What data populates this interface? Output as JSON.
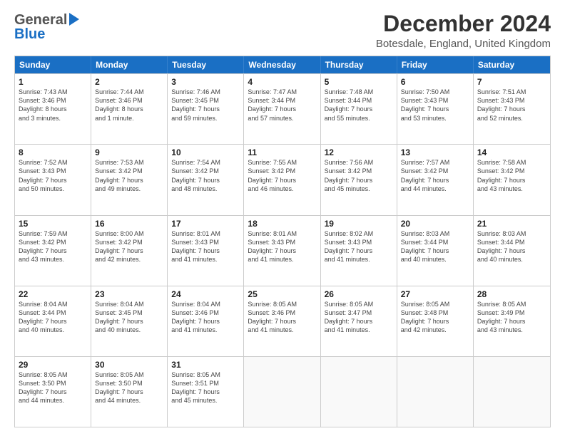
{
  "logo": {
    "line1": "General",
    "line2": "Blue",
    "icon": "▶"
  },
  "title": {
    "month": "December 2024",
    "location": "Botesdale, England, United Kingdom"
  },
  "header_days": [
    "Sunday",
    "Monday",
    "Tuesday",
    "Wednesday",
    "Thursday",
    "Friday",
    "Saturday"
  ],
  "weeks": [
    [
      {
        "day": "1",
        "info": "Sunrise: 7:43 AM\nSunset: 3:46 PM\nDaylight: 8 hours\nand 3 minutes."
      },
      {
        "day": "2",
        "info": "Sunrise: 7:44 AM\nSunset: 3:46 PM\nDaylight: 8 hours\nand 1 minute."
      },
      {
        "day": "3",
        "info": "Sunrise: 7:46 AM\nSunset: 3:45 PM\nDaylight: 7 hours\nand 59 minutes."
      },
      {
        "day": "4",
        "info": "Sunrise: 7:47 AM\nSunset: 3:44 PM\nDaylight: 7 hours\nand 57 minutes."
      },
      {
        "day": "5",
        "info": "Sunrise: 7:48 AM\nSunset: 3:44 PM\nDaylight: 7 hours\nand 55 minutes."
      },
      {
        "day": "6",
        "info": "Sunrise: 7:50 AM\nSunset: 3:43 PM\nDaylight: 7 hours\nand 53 minutes."
      },
      {
        "day": "7",
        "info": "Sunrise: 7:51 AM\nSunset: 3:43 PM\nDaylight: 7 hours\nand 52 minutes."
      }
    ],
    [
      {
        "day": "8",
        "info": "Sunrise: 7:52 AM\nSunset: 3:43 PM\nDaylight: 7 hours\nand 50 minutes."
      },
      {
        "day": "9",
        "info": "Sunrise: 7:53 AM\nSunset: 3:42 PM\nDaylight: 7 hours\nand 49 minutes."
      },
      {
        "day": "10",
        "info": "Sunrise: 7:54 AM\nSunset: 3:42 PM\nDaylight: 7 hours\nand 48 minutes."
      },
      {
        "day": "11",
        "info": "Sunrise: 7:55 AM\nSunset: 3:42 PM\nDaylight: 7 hours\nand 46 minutes."
      },
      {
        "day": "12",
        "info": "Sunrise: 7:56 AM\nSunset: 3:42 PM\nDaylight: 7 hours\nand 45 minutes."
      },
      {
        "day": "13",
        "info": "Sunrise: 7:57 AM\nSunset: 3:42 PM\nDaylight: 7 hours\nand 44 minutes."
      },
      {
        "day": "14",
        "info": "Sunrise: 7:58 AM\nSunset: 3:42 PM\nDaylight: 7 hours\nand 43 minutes."
      }
    ],
    [
      {
        "day": "15",
        "info": "Sunrise: 7:59 AM\nSunset: 3:42 PM\nDaylight: 7 hours\nand 43 minutes."
      },
      {
        "day": "16",
        "info": "Sunrise: 8:00 AM\nSunset: 3:42 PM\nDaylight: 7 hours\nand 42 minutes."
      },
      {
        "day": "17",
        "info": "Sunrise: 8:01 AM\nSunset: 3:43 PM\nDaylight: 7 hours\nand 41 minutes."
      },
      {
        "day": "18",
        "info": "Sunrise: 8:01 AM\nSunset: 3:43 PM\nDaylight: 7 hours\nand 41 minutes."
      },
      {
        "day": "19",
        "info": "Sunrise: 8:02 AM\nSunset: 3:43 PM\nDaylight: 7 hours\nand 41 minutes."
      },
      {
        "day": "20",
        "info": "Sunrise: 8:03 AM\nSunset: 3:44 PM\nDaylight: 7 hours\nand 40 minutes."
      },
      {
        "day": "21",
        "info": "Sunrise: 8:03 AM\nSunset: 3:44 PM\nDaylight: 7 hours\nand 40 minutes."
      }
    ],
    [
      {
        "day": "22",
        "info": "Sunrise: 8:04 AM\nSunset: 3:44 PM\nDaylight: 7 hours\nand 40 minutes."
      },
      {
        "day": "23",
        "info": "Sunrise: 8:04 AM\nSunset: 3:45 PM\nDaylight: 7 hours\nand 40 minutes."
      },
      {
        "day": "24",
        "info": "Sunrise: 8:04 AM\nSunset: 3:46 PM\nDaylight: 7 hours\nand 41 minutes."
      },
      {
        "day": "25",
        "info": "Sunrise: 8:05 AM\nSunset: 3:46 PM\nDaylight: 7 hours\nand 41 minutes."
      },
      {
        "day": "26",
        "info": "Sunrise: 8:05 AM\nSunset: 3:47 PM\nDaylight: 7 hours\nand 41 minutes."
      },
      {
        "day": "27",
        "info": "Sunrise: 8:05 AM\nSunset: 3:48 PM\nDaylight: 7 hours\nand 42 minutes."
      },
      {
        "day": "28",
        "info": "Sunrise: 8:05 AM\nSunset: 3:49 PM\nDaylight: 7 hours\nand 43 minutes."
      }
    ],
    [
      {
        "day": "29",
        "info": "Sunrise: 8:05 AM\nSunset: 3:50 PM\nDaylight: 7 hours\nand 44 minutes."
      },
      {
        "day": "30",
        "info": "Sunrise: 8:05 AM\nSunset: 3:50 PM\nDaylight: 7 hours\nand 44 minutes."
      },
      {
        "day": "31",
        "info": "Sunrise: 8:05 AM\nSunset: 3:51 PM\nDaylight: 7 hours\nand 45 minutes."
      },
      {
        "day": "",
        "info": ""
      },
      {
        "day": "",
        "info": ""
      },
      {
        "day": "",
        "info": ""
      },
      {
        "day": "",
        "info": ""
      }
    ]
  ]
}
